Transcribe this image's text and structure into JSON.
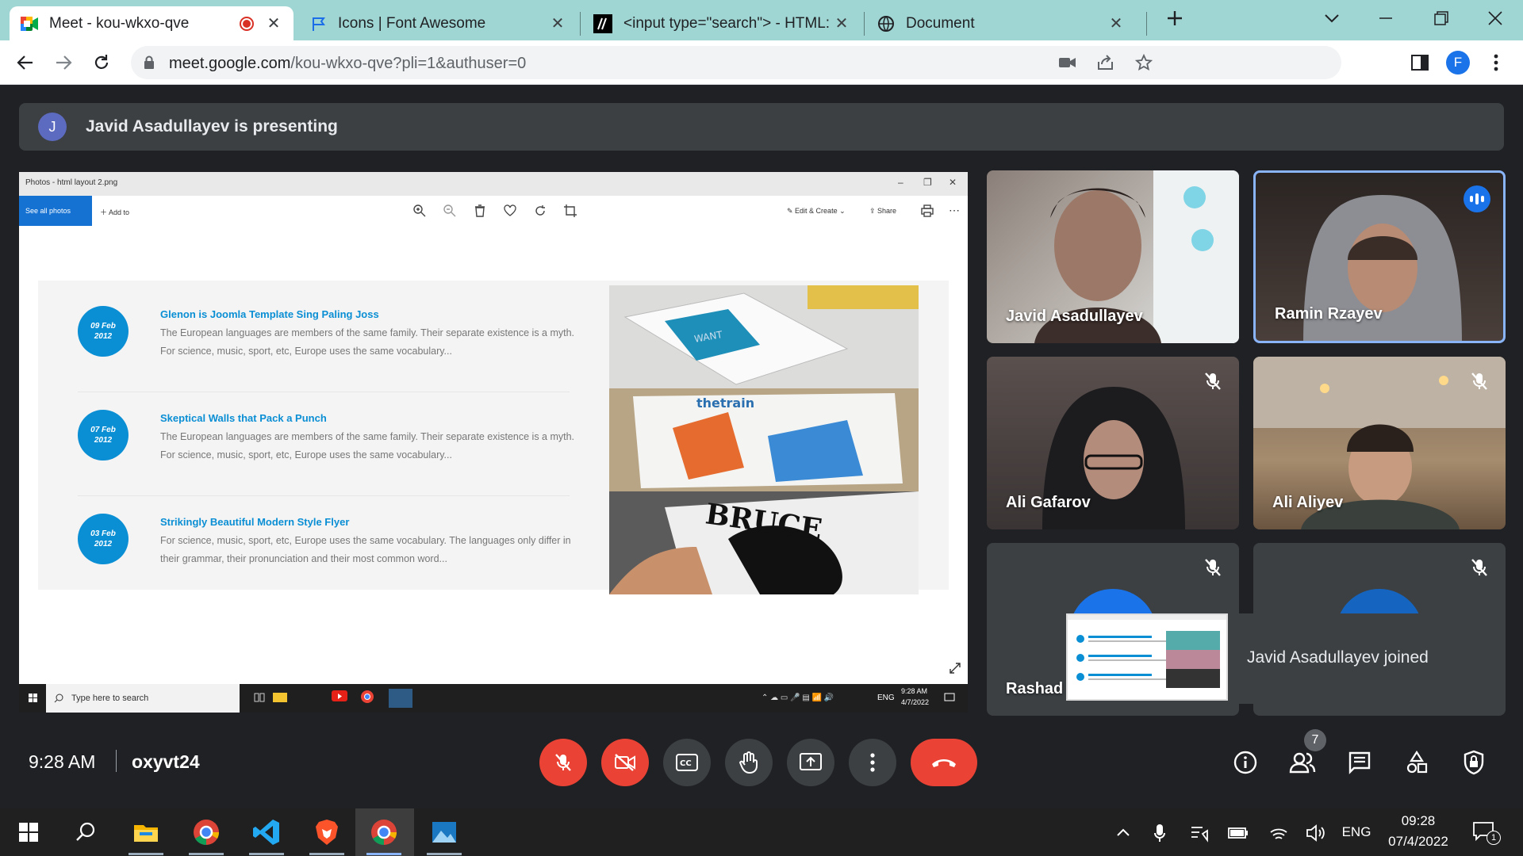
{
  "browser": {
    "tabs": [
      {
        "title": "Meet - kou-wkxo-qve",
        "icon": "google-meet-icon"
      },
      {
        "title": "Icons | Font Awesome",
        "icon": "font-awesome-flag-icon"
      },
      {
        "title": "<input type=\"search\"> - HTML: I",
        "icon": "mdn-icon"
      },
      {
        "title": "Document",
        "icon": "globe-icon"
      }
    ],
    "url_host": "meet.google.com",
    "url_path": "/kou-wkxo-qve?pli=1&authuser=0",
    "profile_initial": "F"
  },
  "meet": {
    "presenter_initial": "J",
    "presenting_text": "Javid Asadullayev is presenting",
    "shared_screen": {
      "window_title": "Photos - html layout 2.png",
      "see_all": "See all photos",
      "add_to": "Add to",
      "edit_create": "Edit & Create",
      "share": "Share",
      "posts": [
        {
          "day": "09 Feb",
          "year": "2012",
          "title": "Glenon is Joomla Template Sing Paling Joss",
          "text": "The European languages are members of the same family. Their separate existence is a myth. For science, music, sport, etc, Europe uses the same vocabulary..."
        },
        {
          "day": "07 Feb",
          "year": "2012",
          "title": "Skeptical Walls that Pack a Punch",
          "text": "The European languages are members of the same family. Their separate existence is a myth. For science, music, sport, etc, Europe uses the same vocabulary..."
        },
        {
          "day": "03 Feb",
          "year": "2012",
          "title": "Strikingly Beautiful Modern Style Flyer",
          "text": "For science, music, sport, etc, Europe uses the same vocabulary. The languages only differ in their grammar, their pronunciation and their most common word..."
        }
      ],
      "image_captions": [
        "WANT",
        "thetrain",
        "BRUCE"
      ],
      "taskbar_search": "Type here to search",
      "tray_lang": "ENG",
      "tray_time": "9:28 AM",
      "tray_date": "4/7/2022"
    },
    "participants": [
      {
        "name": "Javid Asadullayev",
        "muted": false,
        "speaking": false
      },
      {
        "name": "Ramin Rzayev",
        "muted": false,
        "speaking": true
      },
      {
        "name": "Ali Gafarov",
        "muted": true,
        "speaking": false
      },
      {
        "name": "Ali Aliyev",
        "muted": true,
        "speaking": false
      },
      {
        "name": "Rashad I",
        "muted": true,
        "speaking": false
      },
      {
        "name": "",
        "muted": true,
        "speaking": false
      }
    ],
    "toast": "Javid Asadullayev joined",
    "time": "9:28 AM",
    "meeting_code": "oxyvt24",
    "people_count": "7",
    "colors": {
      "accent": "#1a73e8",
      "danger": "#ea4335",
      "surface": "#3c4043",
      "background": "#202124"
    }
  },
  "windows_taskbar": {
    "lang": "ENG",
    "time": "09:28",
    "date": "07/4/2022",
    "notifications": "1"
  }
}
